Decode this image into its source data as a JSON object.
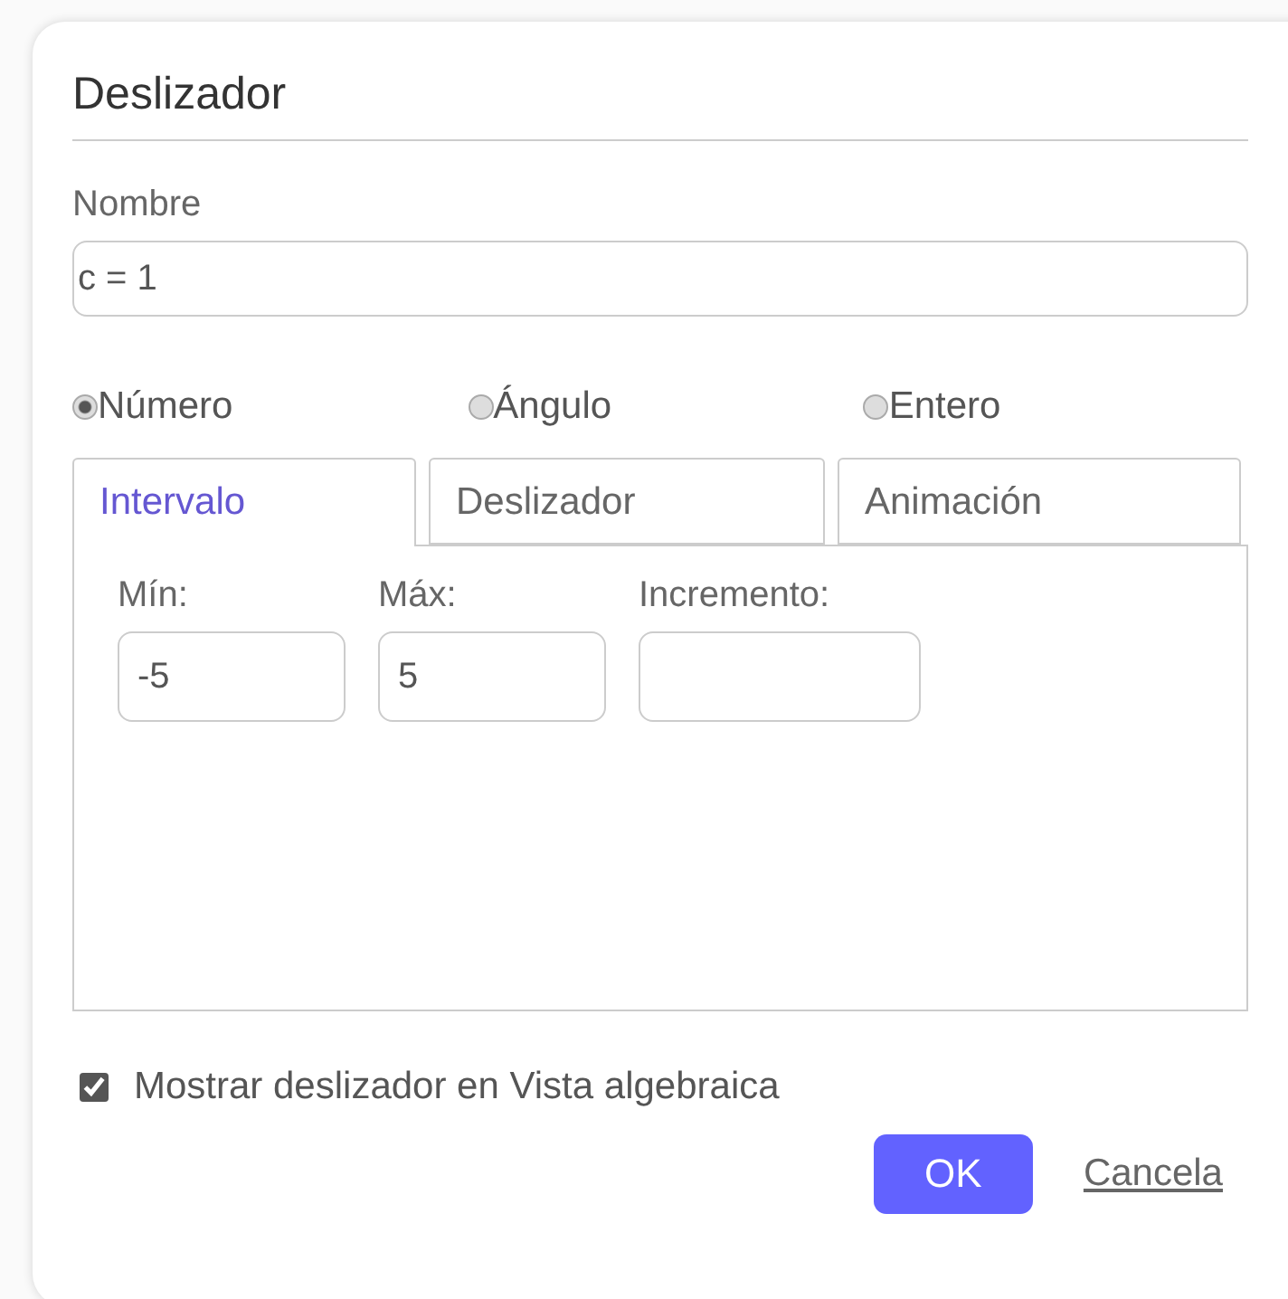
{
  "dialog": {
    "title": "Deslizador",
    "name_label": "Nombre",
    "name_value": "c = 1",
    "types": [
      {
        "label": "Número",
        "selected": true
      },
      {
        "label": "Ángulo",
        "selected": false
      },
      {
        "label": "Entero",
        "selected": false
      }
    ],
    "tabs": [
      {
        "label": "Intervalo",
        "selected": true
      },
      {
        "label": "Deslizador",
        "selected": false
      },
      {
        "label": "Animación",
        "selected": false
      }
    ],
    "fields": [
      {
        "label": "Mín:",
        "value": "-5"
      },
      {
        "label": "Máx:",
        "value": "5"
      },
      {
        "label": "Incremento:"
      }
    ],
    "show_in_algebra": {
      "label": "Mostrar deslizador en Vista algebraica",
      "checked": true
    },
    "buttons": {
      "ok": "OK",
      "cancel": "Cancela"
    }
  }
}
